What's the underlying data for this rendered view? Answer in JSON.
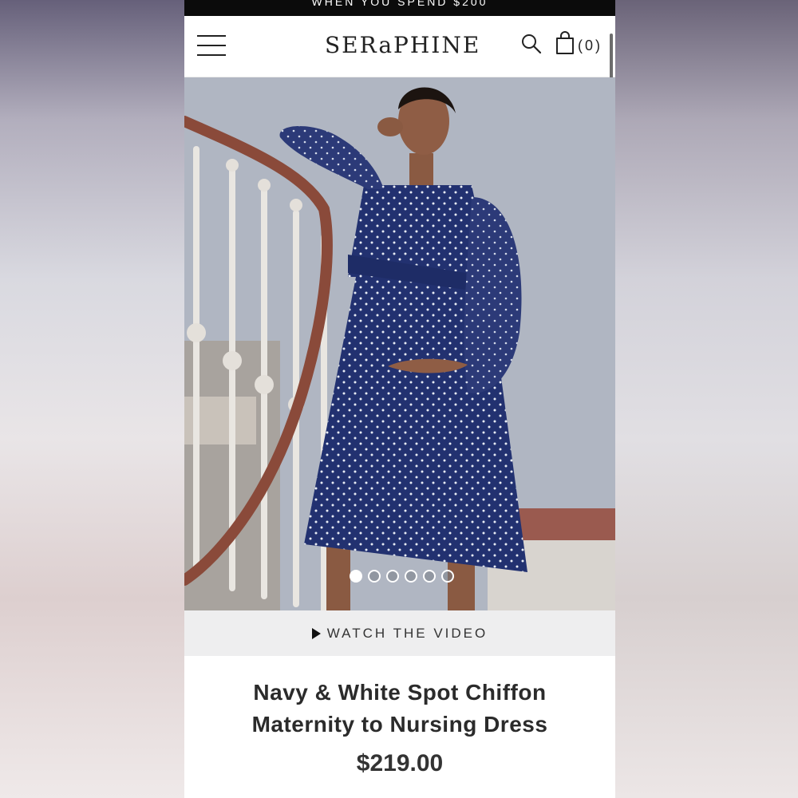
{
  "promo": {
    "text": "WHEN YOU SPEND $200"
  },
  "header": {
    "logo": "SERaPHINE",
    "cart_count": "(0)"
  },
  "gallery": {
    "slide_count": 6,
    "active_slide": 1
  },
  "video": {
    "label": "WATCH THE VIDEO"
  },
  "product": {
    "title": "Navy & White Spot Chiffon Maternity to Nursing Dress",
    "price": "$219.00"
  },
  "colors": {
    "dress": "#223170",
    "background_wall": "#b0b6c2",
    "banister": "#8a4a3a",
    "promo_bar": "#0b0b0b"
  },
  "icons": [
    "menu-icon",
    "search-icon",
    "shopping-bag-icon",
    "play-icon"
  ]
}
